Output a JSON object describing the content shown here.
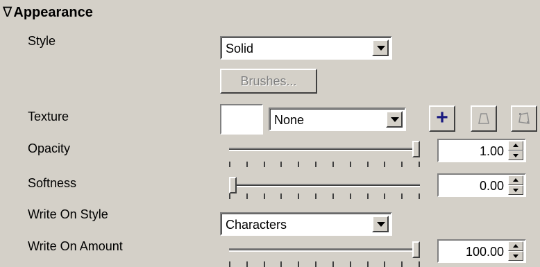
{
  "section": {
    "title": "Appearance",
    "collapse_glyph": "∇"
  },
  "style": {
    "label": "Style",
    "value": "Solid",
    "brushes_label": "Brushes..."
  },
  "texture": {
    "label": "Texture",
    "value": "None",
    "add_glyph": "+"
  },
  "opacity": {
    "label": "Opacity",
    "value": "1.00",
    "level": 1.0
  },
  "softness": {
    "label": "Softness",
    "value": "0.00",
    "level": 0.0
  },
  "write_on_style": {
    "label": "Write On Style",
    "value": "Characters"
  },
  "write_on_amount": {
    "label": "Write On Amount",
    "value": "100.00",
    "level": 1.0
  },
  "colors": {
    "background": "#d4d0c8",
    "plus": "#1a1a80"
  }
}
